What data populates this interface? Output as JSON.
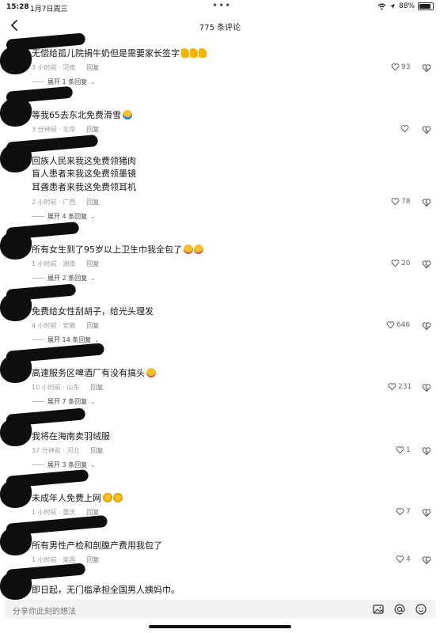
{
  "status": {
    "time": "15:28",
    "date": "1月7日周三",
    "battery": "88%",
    "battery_fraction": 0.88
  },
  "header": {
    "title": "775 条评论"
  },
  "comments": [
    {
      "text": "无偿给孤儿院捐牛奶但是需要家长签字",
      "emoji": [
        "thumb",
        "thumb",
        "thumb"
      ],
      "time": "3 小时前 · 河南",
      "reply": "回复",
      "likes": "93",
      "expand": "展开 1 条回复"
    },
    {
      "text": "等我65去东北免费滑雪",
      "emoji": [
        "laugh"
      ],
      "time": "3 分钟前 · 北京",
      "reply": "回复",
      "likes": "",
      "expand": ""
    },
    {
      "lines": [
        "回族人民来我这免费领猪肉",
        "盲人患者来我这免费领墨镜",
        "耳聋患者来我这免费领耳机"
      ],
      "time": "2 小时前 · 广西",
      "reply": "回复",
      "likes": "78",
      "expand": "展开 4 条回复"
    },
    {
      "text": "所有女生到了95岁以上卫生巾我全包了",
      "emoji": [
        "smile",
        "smile"
      ],
      "time": "1 小时前 · 湖南",
      "reply": "回复",
      "likes": "20",
      "expand": "展开 2 条回复"
    },
    {
      "text": "免费给女性刮胡子，给光头理发",
      "emoji": [],
      "time": "4 小时前 · 安徽",
      "reply": "回复",
      "likes": "646",
      "expand": "展开 14 条回复"
    },
    {
      "text": "高速服务区啤酒厂有没有搞头",
      "emoji": [
        "smile"
      ],
      "time": "10 小时前 · 山东",
      "reply": "回复",
      "likes": "231",
      "expand": "展开 7 条回复"
    },
    {
      "text": "我将在海南卖羽绒服",
      "emoji": [],
      "time": "37 分钟前 · 河北",
      "reply": "回复",
      "likes": "1",
      "expand": "展开 3 条回复"
    },
    {
      "text": "未成年人免费上网",
      "emoji": [
        "face",
        "face"
      ],
      "time": "1 小时前 · 重庆",
      "reply": "回复",
      "likes": "7",
      "expand": ""
    },
    {
      "text": "所有男性产检和剖腹产费用我包了",
      "emoji": [],
      "time": "1 小时前 · 英国",
      "reply": "回复",
      "likes": "4",
      "expand": ""
    },
    {
      "text": "即日起，无门槛承担全国男人姨妈巾。",
      "emoji": [],
      "time": "",
      "reply": "",
      "likes": "",
      "expand": ""
    }
  ],
  "input": {
    "placeholder": "分享你此刻的想法"
  },
  "icons": {
    "back": "back-arrow-icon",
    "like": "heart-icon",
    "dislike": "broken-heart-icon",
    "input": [
      "image-icon",
      "at-icon",
      "emoji-icon"
    ]
  }
}
